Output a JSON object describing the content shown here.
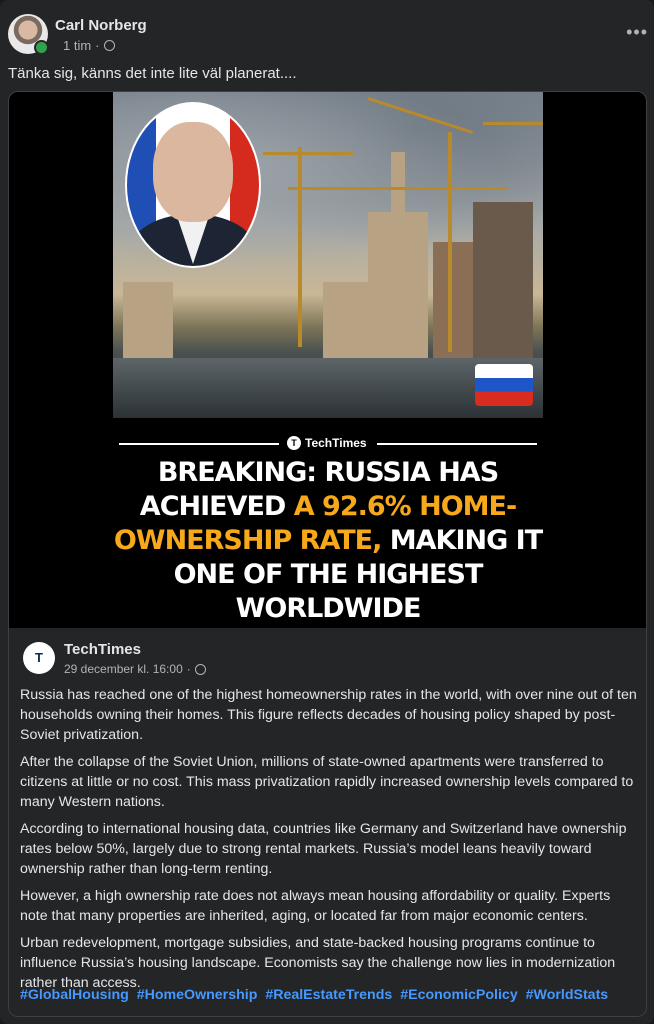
{
  "post": {
    "author": "Carl Norberg",
    "time": "1 tim",
    "separator": "·",
    "text": "Tänka sig, känns det inte lite väl planerat....",
    "more": "•••"
  },
  "shared": {
    "image_brand": "TechTimes",
    "brand_logo_text": "T",
    "headline_part1": "BREAKING: RUSSIA HAS ACHIEVED ",
    "headline_highlight": "A 92.6% HOME-OWNERSHIP RATE,",
    "headline_part2": " MAKING IT ONE OF THE HIGHEST WORLDWIDE",
    "source_name": "TechTimes",
    "source_avatar_text": "T",
    "source_date": "29 december kl. 16:00",
    "separator": "·",
    "paragraphs": [
      "Russia has reached one of the highest homeownership rates in the world, with over nine out of ten households owning their homes. This figure reflects decades of housing policy shaped by post-Soviet privatization.",
      "After the collapse of the Soviet Union, millions of state-owned apartments were transferred to citizens at little or no cost. This mass privatization rapidly increased ownership levels compared to many Western nations.",
      "According to international housing data, countries like Germany and Switzerland have ownership rates below 50%, largely due to strong rental markets. Russia’s model leans heavily toward ownership rather than long-term renting.",
      "However, a high ownership rate does not always mean housing affordability or quality. Experts note that many properties are inherited, aging, or located far from major economic centers.",
      "Urban redevelopment, mortgage subsidies, and state-backed housing programs continue to influence Russia’s housing landscape. Economists say the challenge now lies in modernization rather than access."
    ],
    "hashtags": [
      "#GlobalHousing",
      "#HomeOwnership",
      "#RealEstateTrends",
      "#EconomicPolicy",
      "#WorldStats"
    ]
  },
  "icons": {
    "privacy": "globe-icon",
    "menu": "more-options-icon"
  },
  "colors": {
    "background": "#242526",
    "text": "#e4e6eb",
    "secondary": "#b0b3b8",
    "hashtag": "#4599ff",
    "highlight": "#f7a81b"
  }
}
